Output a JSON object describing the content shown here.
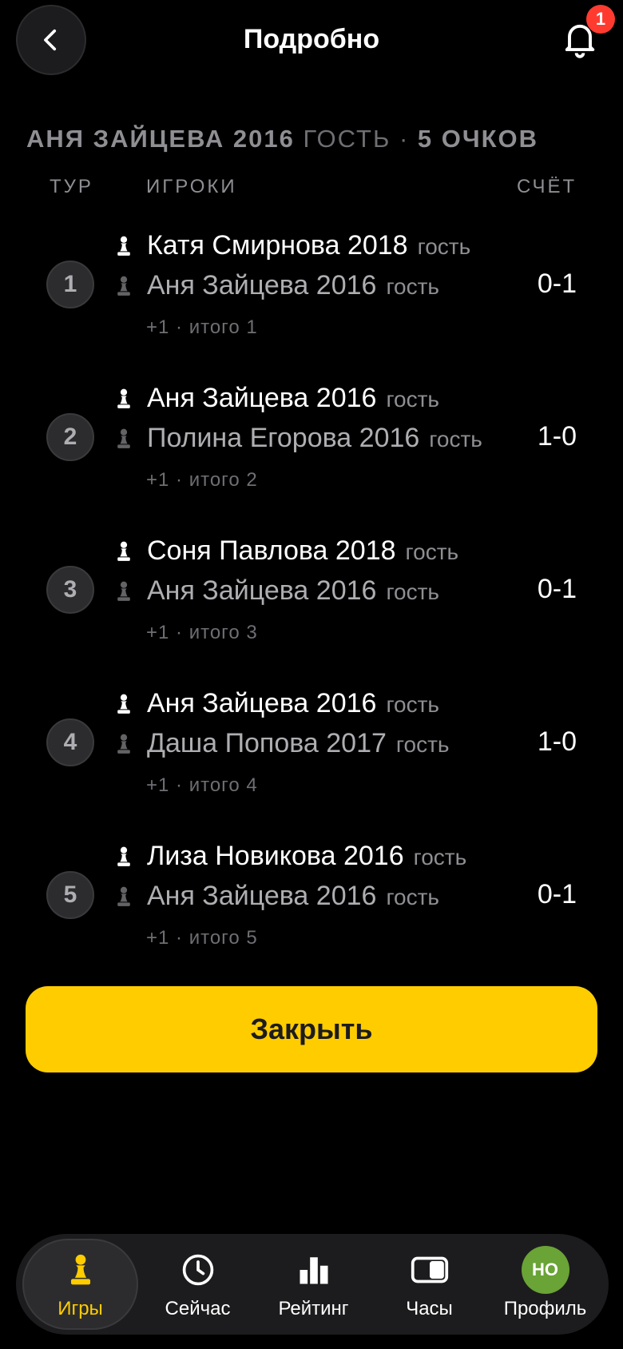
{
  "header": {
    "title": "Подробно",
    "notification_count": "1"
  },
  "summary": {
    "name": "АНЯ ЗАЙЦЕВА 2016",
    "guest": "ГОСТЬ",
    "separator": "·",
    "points": "5 ОЧКОВ"
  },
  "columns": {
    "round": "ТУР",
    "players": "ИГРОКИ",
    "score": "СЧЁТ"
  },
  "rounds": [
    {
      "number": "1",
      "white": "Катя Смирнова 2018",
      "white_tag": "гость",
      "black": "Аня Зайцева 2016",
      "black_tag": "гость",
      "note": "+1 · итого 1",
      "score": "0-1"
    },
    {
      "number": "2",
      "white": "Аня Зайцева 2016",
      "white_tag": "гость",
      "black": "Полина Егорова 2016",
      "black_tag": "гость",
      "note": "+1 · итого 2",
      "score": "1-0"
    },
    {
      "number": "3",
      "white": "Соня Павлова 2018",
      "white_tag": "гость",
      "black": "Аня Зайцева 2016",
      "black_tag": "гость",
      "note": "+1 · итого 3",
      "score": "0-1"
    },
    {
      "number": "4",
      "white": "Аня Зайцева 2016",
      "white_tag": "гость",
      "black": "Даша Попова 2017",
      "black_tag": "гость",
      "note": "+1 · итого 4",
      "score": "1-0"
    },
    {
      "number": "5",
      "white": "Лиза Новикова 2016",
      "white_tag": "гость",
      "black": "Аня Зайцева 2016",
      "black_tag": "гость",
      "note": "+1 · итого 5",
      "score": "0-1"
    }
  ],
  "close_button": "Закрыть",
  "tabbar": {
    "items": [
      {
        "label": "Игры",
        "icon": "pawn-icon",
        "active": true
      },
      {
        "label": "Сейчас",
        "icon": "clock-icon",
        "active": false
      },
      {
        "label": "Рейтинг",
        "icon": "bar-chart-icon",
        "active": false
      },
      {
        "label": "Часы",
        "icon": "chess-clock-icon",
        "active": false
      },
      {
        "label": "Профиль",
        "icon": "avatar",
        "active": false
      }
    ],
    "avatar_initials": "НО"
  },
  "colors": {
    "accent": "#ffcc00",
    "background": "#000000",
    "badge": "#ff3b30",
    "avatar": "#6aa336"
  }
}
